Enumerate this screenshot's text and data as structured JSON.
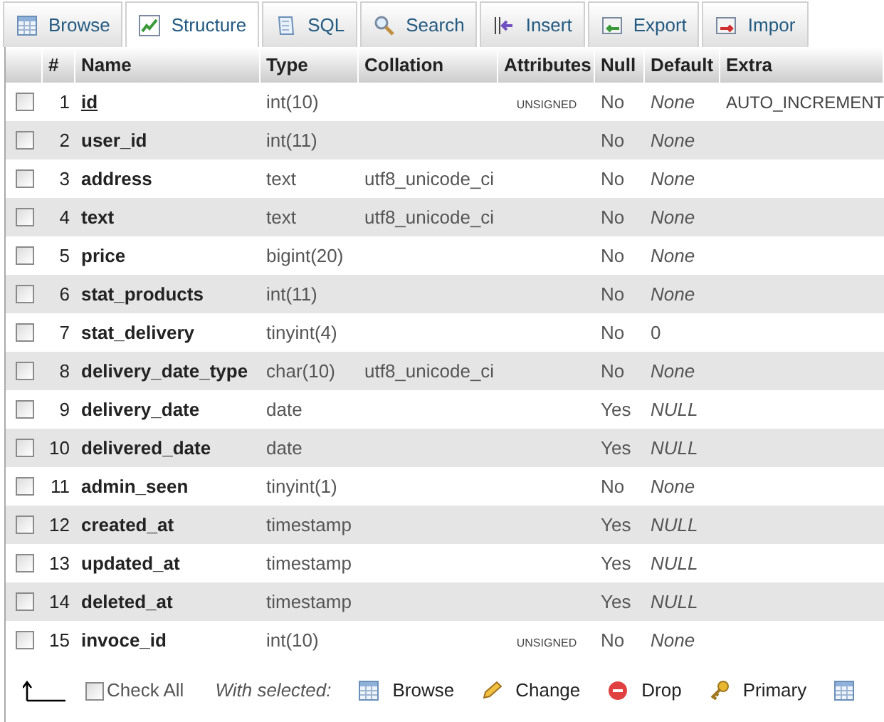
{
  "tabs": [
    {
      "label": "Browse",
      "kind": "browse",
      "selected": false
    },
    {
      "label": "Structure",
      "kind": "structure",
      "selected": true
    },
    {
      "label": "SQL",
      "kind": "sql",
      "selected": false
    },
    {
      "label": "Search",
      "kind": "search",
      "selected": false
    },
    {
      "label": "Insert",
      "kind": "insert",
      "selected": false
    },
    {
      "label": "Export",
      "kind": "export",
      "selected": false
    },
    {
      "label": "Impor",
      "kind": "import",
      "selected": false
    }
  ],
  "table": {
    "columns": [
      "#",
      "Name",
      "Type",
      "Collation",
      "Attributes",
      "Null",
      "Default",
      "Extra"
    ],
    "rows": [
      {
        "checked": false,
        "num": "1",
        "name": "id",
        "primary": true,
        "type": "int(10)",
        "collation": "",
        "attributes": "UNSIGNED",
        "null": "No",
        "default": "None",
        "extra": "AUTO_INCREMENT"
      },
      {
        "checked": false,
        "num": "2",
        "name": "user_id",
        "primary": false,
        "type": "int(11)",
        "collation": "",
        "attributes": "",
        "null": "No",
        "default": "None",
        "extra": ""
      },
      {
        "checked": false,
        "num": "3",
        "name": "address",
        "primary": false,
        "type": "text",
        "collation": "utf8_unicode_ci",
        "attributes": "",
        "null": "No",
        "default": "None",
        "extra": ""
      },
      {
        "checked": false,
        "num": "4",
        "name": "text",
        "primary": false,
        "type": "text",
        "collation": "utf8_unicode_ci",
        "attributes": "",
        "null": "No",
        "default": "None",
        "extra": ""
      },
      {
        "checked": false,
        "num": "5",
        "name": "price",
        "primary": false,
        "type": "bigint(20)",
        "collation": "",
        "attributes": "",
        "null": "No",
        "default": "None",
        "extra": ""
      },
      {
        "checked": false,
        "num": "6",
        "name": "stat_products",
        "primary": false,
        "type": "int(11)",
        "collation": "",
        "attributes": "",
        "null": "No",
        "default": "None",
        "extra": ""
      },
      {
        "checked": false,
        "num": "7",
        "name": "stat_delivery",
        "primary": false,
        "type": "tinyint(4)",
        "collation": "",
        "attributes": "",
        "null": "No",
        "default": "0",
        "default_plain": true,
        "extra": ""
      },
      {
        "checked": false,
        "num": "8",
        "name": "delivery_date_type",
        "primary": false,
        "type": "char(10)",
        "collation": "utf8_unicode_ci",
        "attributes": "",
        "null": "No",
        "default": "None",
        "extra": ""
      },
      {
        "checked": false,
        "num": "9",
        "name": "delivery_date",
        "primary": false,
        "type": "date",
        "collation": "",
        "attributes": "",
        "null": "Yes",
        "default": "NULL",
        "extra": ""
      },
      {
        "checked": false,
        "num": "10",
        "name": "delivered_date",
        "primary": false,
        "type": "date",
        "collation": "",
        "attributes": "",
        "null": "Yes",
        "default": "NULL",
        "extra": ""
      },
      {
        "checked": false,
        "num": "11",
        "name": "admin_seen",
        "primary": false,
        "type": "tinyint(1)",
        "collation": "",
        "attributes": "",
        "null": "No",
        "default": "None",
        "extra": ""
      },
      {
        "checked": false,
        "num": "12",
        "name": "created_at",
        "primary": false,
        "type": "timestamp",
        "collation": "",
        "attributes": "",
        "null": "Yes",
        "default": "NULL",
        "extra": ""
      },
      {
        "checked": false,
        "num": "13",
        "name": "updated_at",
        "primary": false,
        "type": "timestamp",
        "collation": "",
        "attributes": "",
        "null": "Yes",
        "default": "NULL",
        "extra": ""
      },
      {
        "checked": false,
        "num": "14",
        "name": "deleted_at",
        "primary": false,
        "type": "timestamp",
        "collation": "",
        "attributes": "",
        "null": "Yes",
        "default": "NULL",
        "extra": ""
      },
      {
        "checked": false,
        "num": "15",
        "name": "invoce_id",
        "primary": false,
        "type": "int(10)",
        "collation": "",
        "attributes": "UNSIGNED",
        "null": "No",
        "default": "None",
        "extra": ""
      }
    ]
  },
  "footer": {
    "check_all": {
      "label": "Check All",
      "checked": false
    },
    "with_selected": "With selected:",
    "actions": [
      {
        "label": "Browse",
        "kind": "browse"
      },
      {
        "label": "Change",
        "kind": "change"
      },
      {
        "label": "Drop",
        "kind": "drop"
      },
      {
        "label": "Primary",
        "kind": "primary"
      },
      {
        "kind": "unique"
      }
    ]
  }
}
